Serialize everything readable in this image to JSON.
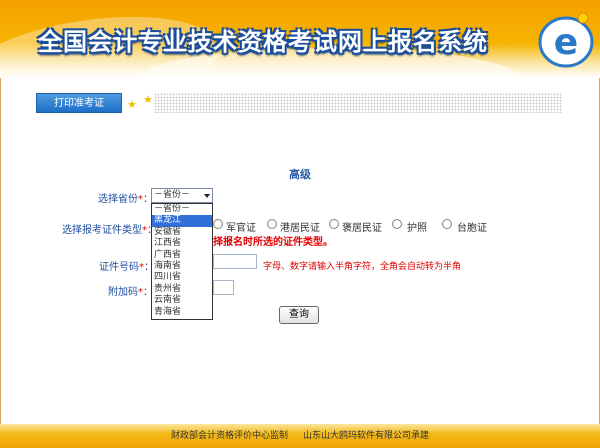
{
  "banner": {
    "title": "全国会计专业技术资格考试网上报名系统",
    "logo_letter": "e"
  },
  "nav": {
    "print_tab": "打印准考证"
  },
  "form": {
    "heading": "高级",
    "province_label": "选择省份",
    "province_selected": "－省份－",
    "province_options": [
      "－省份－",
      "黑龙江",
      "安徽省",
      "江西省",
      "广西省",
      "海南省",
      "四川省",
      "贵州省",
      "云南省",
      "青海省"
    ],
    "id_type_label": "选择报考证件类型",
    "id_types": [
      "军官证",
      "港居民证",
      "褒居民证",
      "护照",
      "台胞证"
    ],
    "id_warning": "择报名时所选的证件类型。",
    "id_number_label": "证件号码",
    "id_hint": "字母、数字请输入半角字符，全角会自动转为半角",
    "extra_code_label": "附加码",
    "required_mark": "*",
    "colon": "：",
    "query_button": "查询"
  },
  "footer": {
    "supervisor": "财政部会计资格评价中心监制",
    "developer": "山东山大鸥玛软件有限公司承建"
  },
  "colors": {
    "banner_orange": "#f5a000",
    "title_blue": "#1a4d9a",
    "label_blue": "#1f4fa0",
    "required_red": "#e00000",
    "selected_option": "#3170d8"
  }
}
